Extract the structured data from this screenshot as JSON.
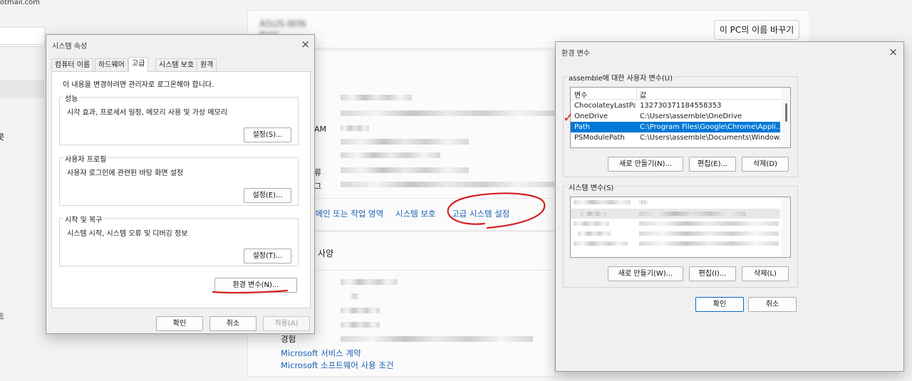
{
  "background": {
    "email_partial": "otmail.com",
    "rename_pc_button": "이 PC의 이름 바꾸기",
    "side_fragments": [
      "AM",
      "류",
      "그"
    ],
    "left_fragments": [
      "콧",
      "트"
    ],
    "related_links": [
      "도메인 또는 작업 영역",
      "시스템 보호",
      "고급 시스템 설정"
    ],
    "spec_heading_partial": "사양",
    "experience_label": "경험",
    "links": [
      "Microsoft 서비스 계약",
      "Microsoft 소프트웨어 사용 조건"
    ]
  },
  "sysprops": {
    "title": "시스템 속성",
    "tabs": [
      "컴퓨터 이름",
      "하드웨어",
      "고급",
      "시스템 보호",
      "원격"
    ],
    "active_tab": "고급",
    "admin_note": "이 내용을 변경하려면 관리자로 로그온해야 합니다.",
    "performance": {
      "label": "성능",
      "desc": "시각 효과, 프로세서 일정, 메모리 사용 및 가상 메모리",
      "button": "설정(S)..."
    },
    "user_profile": {
      "label": "사용자 프로필",
      "desc": "사용자 로그인에 관련된 바탕 화면 설정",
      "button": "설정(E)..."
    },
    "startup_recovery": {
      "label": "시작 및 복구",
      "desc": "시스템 시작, 시스템 오류 및 디버깅 정보",
      "button": "설정(T)..."
    },
    "env_button": "환경 변수(N)...",
    "ok": "확인",
    "cancel": "취소",
    "apply": "적용(A)"
  },
  "envvars": {
    "title": "환경 변수",
    "user_group_label": "assemble에 대한 사용자 변수(U)",
    "columns": [
      "변수",
      "값"
    ],
    "user_vars": [
      {
        "name": "ChocolateyLastPat...",
        "value": "132730371184558353"
      },
      {
        "name": "OneDrive",
        "value": "C:\\Users\\assemble\\OneDrive"
      },
      {
        "name": "Path",
        "value": "C:\\Program Files\\Google\\Chrome\\Appli..."
      },
      {
        "name": "PSModulePath",
        "value": "C:\\Users\\assemble\\Documents\\Window..."
      }
    ],
    "selected_user_var": "Path",
    "user_buttons": [
      "새로 만들기(N)...",
      "편집(E)...",
      "삭제(D)"
    ],
    "system_group_label": "시스템 변수(S)",
    "system_buttons": [
      "새로 만들기(W)...",
      "편집(I)...",
      "삭제(L)"
    ],
    "ok": "확인",
    "cancel": "취소"
  },
  "annotations": {
    "color": "#d42020",
    "checkmark": "✓"
  }
}
